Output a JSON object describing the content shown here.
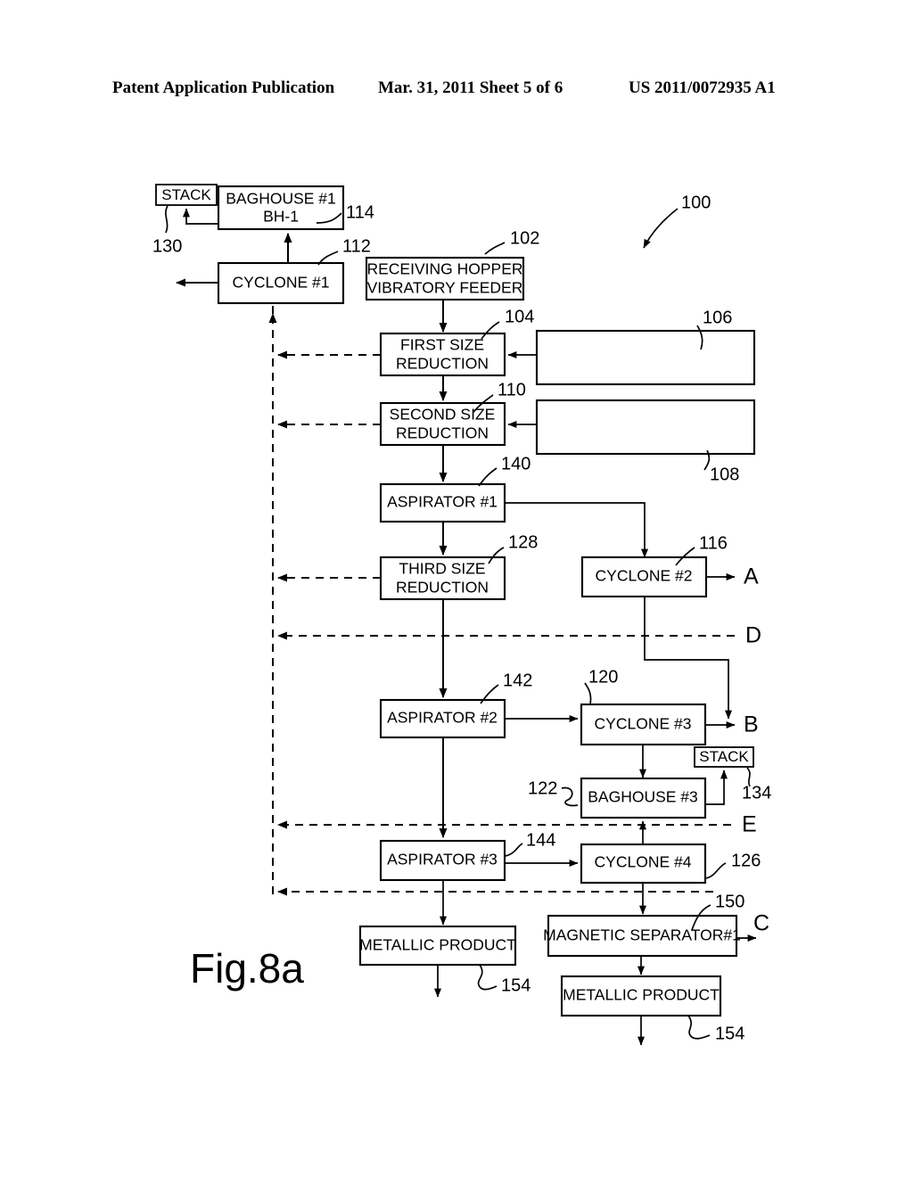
{
  "header": {
    "left": "Patent Application Publication",
    "middle": "Mar. 31, 2011  Sheet 5 of 6",
    "right": "US 2011/0072935 A1"
  },
  "figure": {
    "label": "Fig.8a",
    "system_ref": "100"
  },
  "boxes": [
    {
      "id": "stack1",
      "label": "STACK",
      "ref": "130"
    },
    {
      "id": "baghouse1",
      "label_line1": "BAGHOUSE #1",
      "label_line2": "BH-1",
      "ref": "114"
    },
    {
      "id": "cyclone1",
      "label": "CYCLONE #1",
      "ref": "112"
    },
    {
      "id": "hopper",
      "label_line1": "RECEIVING HOPPER",
      "label_line2": "VIBRATORY FEEDER",
      "ref": "102"
    },
    {
      "id": "first_size",
      "label_line1": "FIRST SIZE",
      "label_line2": "REDUCTION",
      "ref": "104"
    },
    {
      "id": "blank_top",
      "label": "",
      "ref": "106"
    },
    {
      "id": "second_size",
      "label_line1": "SECOND SIZE",
      "label_line2": "REDUCTION",
      "ref": "110"
    },
    {
      "id": "blank_bottom",
      "label": "",
      "ref": "108"
    },
    {
      "id": "aspirator1",
      "label": "ASPIRATOR #1",
      "ref": "140"
    },
    {
      "id": "third_size",
      "label_line1": "THIRD SIZE",
      "label_line2": "REDUCTION",
      "ref": "128"
    },
    {
      "id": "cyclone2",
      "label": "CYCLONE #2",
      "ref": "116"
    },
    {
      "id": "aspirator2",
      "label": "ASPIRATOR #2",
      "ref": "142"
    },
    {
      "id": "cyclone3",
      "label": "CYCLONE #3",
      "ref": "120"
    },
    {
      "id": "stack3",
      "label": "STACK",
      "ref": "134"
    },
    {
      "id": "baghouse3",
      "label": "BAGHOUSE #3",
      "ref": "122"
    },
    {
      "id": "aspirator3",
      "label": "ASPIRATOR #3",
      "ref": "144"
    },
    {
      "id": "cyclone4",
      "label": "CYCLONE #4",
      "ref": "126"
    },
    {
      "id": "metallic_left",
      "label": "METALLIC PRODUCT",
      "ref": "154"
    },
    {
      "id": "magsep",
      "label": "MAGNETIC SEPARATOR#1",
      "ref": "150"
    },
    {
      "id": "metallic_right",
      "label": "METALLIC PRODUCT",
      "ref": "154"
    }
  ],
  "connector_nodes": [
    {
      "id": "node_a",
      "label": "A"
    },
    {
      "id": "node_b",
      "label": "B"
    },
    {
      "id": "node_c",
      "label": "C"
    },
    {
      "id": "node_d",
      "label": "D"
    },
    {
      "id": "node_e",
      "label": "E"
    }
  ],
  "colors": {
    "ink": "#000000",
    "paper": "#ffffff"
  }
}
